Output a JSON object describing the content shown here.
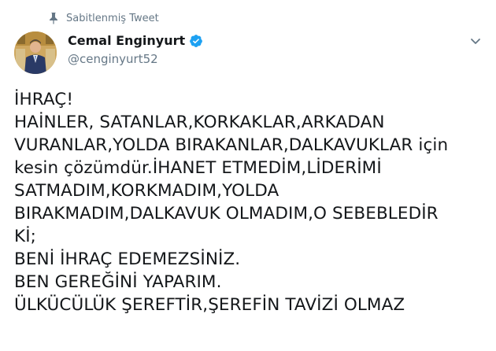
{
  "pinned_label": "Sabitlenmiş Tweet",
  "author": {
    "name": "Cemal Enginyurt",
    "handle": "@cenginyurt52",
    "verified": true
  },
  "tweet_lines": [
    "İHRAÇ!",
    "HAİNLER, SATANLAR,KORKAKLAR,ARKADAN",
    "VURANLAR,YOLDA BIRAKANLAR,DALKAVUKLAR için",
    "kesin çözümdür.İHANET ETMEDİM,LİDERİMİ",
    "SATMADIM,KORKMADIM,YOLDA",
    "BIRAKMADIM,DALKAVUK OLMADIM,O SEBEBLEDİR",
    "Kİ;",
    "BENİ İHRAÇ EDEMEZSİNİZ.",
    "BEN GEREĞİNİ YAPARIM.",
    "ÜLKÜCÜLÜK ŞEREFTİR,ŞEREFİN TAVİZİ OLMAZ"
  ],
  "colors": {
    "verified": "#1da1f2",
    "muted": "#657786",
    "text": "#14171a"
  },
  "icons": [
    "pin-icon",
    "verified-badge-icon",
    "chevron-down-icon"
  ]
}
